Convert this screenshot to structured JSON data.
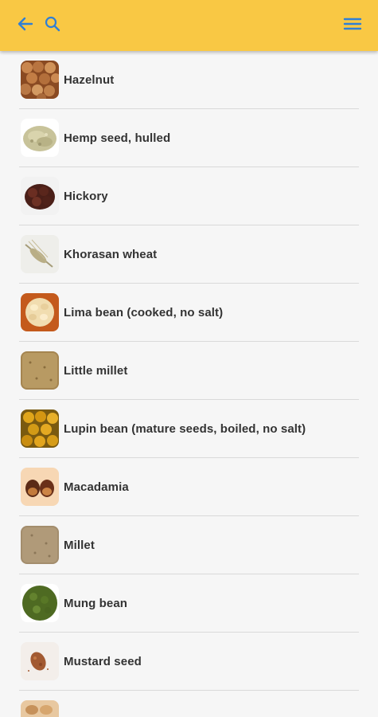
{
  "colors": {
    "appbar": "#f9c844",
    "icon": "#2f7fd6",
    "text": "#333333",
    "divider": "#d9d9d9",
    "background": "#f6f6f6"
  },
  "appbar": {
    "back_icon": "arrow-left-icon",
    "search_icon": "search-icon",
    "menu_icon": "hamburger-menu-icon"
  },
  "items": [
    {
      "label": "Hazelnut",
      "image": "hazelnut"
    },
    {
      "label": "Hemp seed, hulled",
      "image": "hemp-seed"
    },
    {
      "label": "Hickory",
      "image": "hickory"
    },
    {
      "label": "Khorasan wheat",
      "image": "khorasan-wheat"
    },
    {
      "label": "Lima bean (cooked, no salt)",
      "image": "lima-bean"
    },
    {
      "label": "Little millet",
      "image": "little-millet"
    },
    {
      "label": "Lupin bean (mature seeds, boiled, no salt)",
      "image": "lupin-bean"
    },
    {
      "label": "Macadamia",
      "image": "macadamia"
    },
    {
      "label": "Millet",
      "image": "millet"
    },
    {
      "label": "Mung bean",
      "image": "mung-bean"
    },
    {
      "label": "Mustard seed",
      "image": "mustard-seed"
    },
    {
      "label": "",
      "image": "next-item"
    }
  ]
}
